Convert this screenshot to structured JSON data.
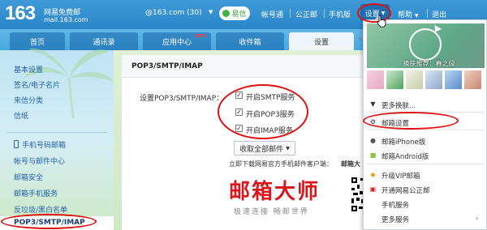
{
  "header": {
    "logo_number": "163",
    "logo_name": "网易免费邮",
    "logo_domain": "mail.163.com",
    "account": "@163.com (30)",
    "yixin_label": "易信",
    "links": [
      "帐号通",
      "公正邮",
      "手机版"
    ],
    "settings_label": "设置",
    "help_label": "帮助",
    "logout_label": "退出"
  },
  "nav": {
    "tabs": [
      "首页",
      "通讯录",
      "应用中心",
      "收件箱",
      "设置"
    ],
    "beta_badge": "BETA",
    "active_tab": "设置"
  },
  "sidebar": {
    "items": [
      "基本设置",
      "签名/电子名片",
      "来信分类",
      "信纸",
      "手机号码邮箱",
      "帐号与邮件中心",
      "邮箱安全",
      "邮箱手机服务",
      "反垃圾/黑白名单",
      "POP3/SMTP/IMAP"
    ],
    "active_item": "POP3/SMTP/IMAP"
  },
  "panel": {
    "title": "POP3/SMTP/IMAP",
    "field_label": "设置POP3/SMTP/IMAP：",
    "options": [
      {
        "label": "开启SMTP服务",
        "checked": true
      },
      {
        "label": "开启POP3服务",
        "checked": true
      },
      {
        "label": "开启IMAP服务",
        "checked": true
      }
    ],
    "collect_button": "收取全部邮件",
    "download_text": "立即下载网易官方手机邮件客户端：",
    "download_bold": "邮箱大",
    "brand_name": "邮箱大师",
    "brand_slogan": "极速连接 畅邮世界"
  },
  "dropdown": {
    "skin_caption": "换肤推荐：春之绿",
    "items": [
      {
        "label": "更多换肤...",
        "icon": "tshirt-icon"
      },
      {
        "label": "邮箱设置",
        "icon": "gear-icon"
      },
      {
        "label": "邮箱iPhone版",
        "icon": "apple-icon"
      },
      {
        "label": "邮箱Android版",
        "icon": "android-icon"
      },
      {
        "label": "升级VIP邮箱",
        "icon": "vip-icon"
      },
      {
        "label": "开通网易公正邮",
        "icon": "notary-icon"
      },
      {
        "label": "手机服务",
        "icon": ""
      },
      {
        "label": "更多服务",
        "icon": ""
      }
    ]
  },
  "colors": {
    "header_blue": "#2a86c8",
    "annotation_red": "#e01010",
    "link_blue": "#2461a8",
    "brand_red": "#d8161b"
  }
}
